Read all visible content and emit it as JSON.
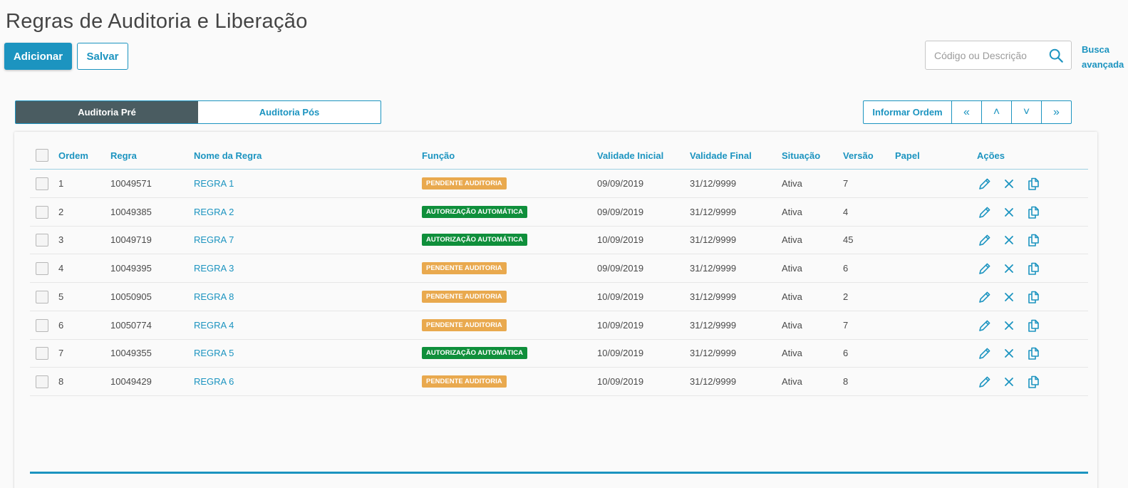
{
  "page": {
    "title": "Regras de Auditoria e Liberação"
  },
  "toolbar": {
    "add_label": "Adicionar",
    "save_label": "Salvar"
  },
  "search": {
    "placeholder": "Código ou Descrição",
    "value": "",
    "advanced_line1": "Busca",
    "advanced_line2": "avançada"
  },
  "tabs": [
    {
      "label": "Auditoria Pré",
      "active": true
    },
    {
      "label": "Auditoria Pós",
      "active": false
    }
  ],
  "order_controls": {
    "inform_label": "Informar Ordem",
    "first": "«",
    "up": "˄",
    "down": "˅",
    "last": "»"
  },
  "table": {
    "columns": [
      "Ordem",
      "Regra",
      "Nome da Regra",
      "Função",
      "Validade Inicial",
      "Validade Final",
      "Situação",
      "Versão",
      "Papel",
      "Ações"
    ],
    "rows": [
      {
        "ordem": "1",
        "regra": "10049571",
        "nome": "REGRA 1",
        "funcao": "PENDENTE AUDITORIA",
        "funcao_type": "pending",
        "inicio": "09/09/2019",
        "fim": "31/12/9999",
        "situacao": "Ativa",
        "versao": "7",
        "papel": ""
      },
      {
        "ordem": "2",
        "regra": "10049385",
        "nome": "REGRA 2",
        "funcao": "AUTORIZAÇÃO AUTOMÁTICA",
        "funcao_type": "auto",
        "inicio": "09/09/2019",
        "fim": "31/12/9999",
        "situacao": "Ativa",
        "versao": "4",
        "papel": ""
      },
      {
        "ordem": "3",
        "regra": "10049719",
        "nome": "REGRA 7",
        "funcao": "AUTORIZAÇÃO AUTOMÁTICA",
        "funcao_type": "auto",
        "inicio": "10/09/2019",
        "fim": "31/12/9999",
        "situacao": "Ativa",
        "versao": "45",
        "papel": ""
      },
      {
        "ordem": "4",
        "regra": "10049395",
        "nome": "REGRA 3",
        "funcao": "PENDENTE AUDITORIA",
        "funcao_type": "pending",
        "inicio": "09/09/2019",
        "fim": "31/12/9999",
        "situacao": "Ativa",
        "versao": "6",
        "papel": ""
      },
      {
        "ordem": "5",
        "regra": "10050905",
        "nome": "REGRA 8",
        "funcao": "PENDENTE AUDITORIA",
        "funcao_type": "pending",
        "inicio": "10/09/2019",
        "fim": "31/12/9999",
        "situacao": "Ativa",
        "versao": "2",
        "papel": ""
      },
      {
        "ordem": "6",
        "regra": "10050774",
        "nome": "REGRA 4",
        "funcao": "PENDENTE AUDITORIA",
        "funcao_type": "pending",
        "inicio": "10/09/2019",
        "fim": "31/12/9999",
        "situacao": "Ativa",
        "versao": "7",
        "papel": ""
      },
      {
        "ordem": "7",
        "regra": "10049355",
        "nome": "REGRA 5",
        "funcao": "AUTORIZAÇÃO AUTOMÁTICA",
        "funcao_type": "auto",
        "inicio": "10/09/2019",
        "fim": "31/12/9999",
        "situacao": "Ativa",
        "versao": "6",
        "papel": ""
      },
      {
        "ordem": "8",
        "regra": "10049429",
        "nome": "REGRA 6",
        "funcao": "PENDENTE AUDITORIA",
        "funcao_type": "pending",
        "inicio": "10/09/2019",
        "fim": "31/12/9999",
        "situacao": "Ativa",
        "versao": "8",
        "papel": ""
      }
    ],
    "row_actions": [
      "pencil-icon",
      "close-icon",
      "copy-icon"
    ]
  },
  "colors": {
    "primary": "#1c94c0",
    "tab_active": "#4a5c61",
    "pending": "#e9a94e",
    "auto": "#0f8f3b"
  }
}
